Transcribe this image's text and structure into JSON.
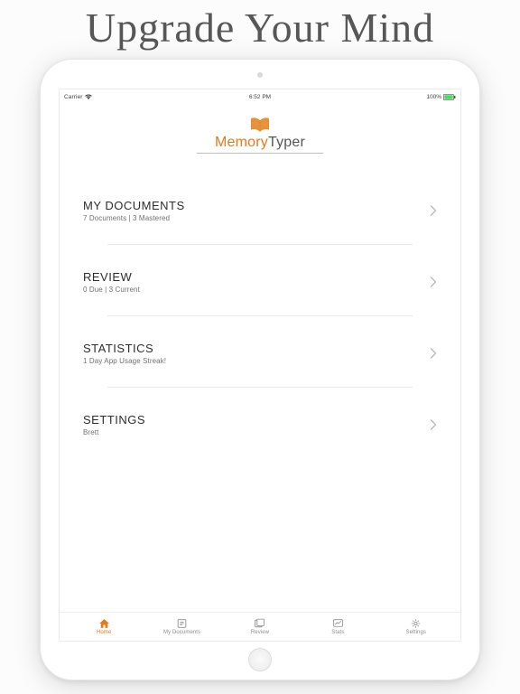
{
  "marketing": {
    "headline": "Upgrade Your Mind"
  },
  "status_bar": {
    "carrier": "Carrier",
    "time": "6:52 PM",
    "battery_text": "100%"
  },
  "brand": {
    "word1": "Memory",
    "word2": "Typer"
  },
  "colors": {
    "accent": "#e37a1b",
    "battery_fill": "#4cd964"
  },
  "menu": {
    "documents": {
      "title": "MY DOCUMENTS",
      "subtitle": "7 Documents | 3 Mastered"
    },
    "review": {
      "title": "REVIEW",
      "subtitle": "0 Due | 3 Current"
    },
    "stats": {
      "title": "STATISTICS",
      "subtitle": "1 Day App Usage Streak!"
    },
    "settings": {
      "title": "SETTINGS",
      "subtitle": "Brett"
    }
  },
  "tabs": {
    "home": {
      "label": "Home"
    },
    "documents": {
      "label": "My Documents"
    },
    "review": {
      "label": "Review"
    },
    "stats": {
      "label": "Stats"
    },
    "settings": {
      "label": "Settings"
    }
  }
}
